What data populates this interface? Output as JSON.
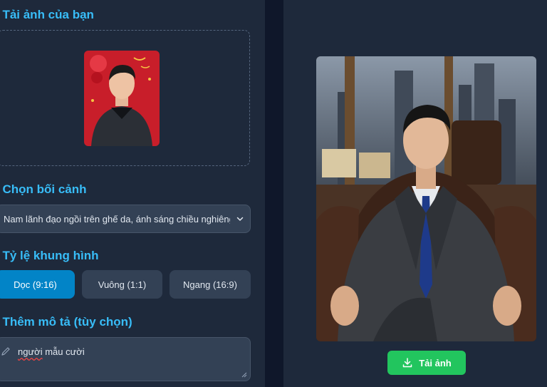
{
  "sections": {
    "upload": {
      "title": ". Tải ảnh của bạn"
    },
    "background": {
      "title": ". Chọn bối cảnh",
      "selected": "Nam lãnh đạo ngồi trên ghế da, ánh sáng chiều nghiêng"
    },
    "ratio": {
      "title": ". Tỷ lệ khung hình",
      "options": [
        {
          "label": "Dọc (9:16)",
          "active": true
        },
        {
          "label": "Vuông (1:1)",
          "active": false
        },
        {
          "label": "Ngang (16:9)",
          "active": false
        }
      ]
    },
    "description": {
      "title": ". Thêm mô tả (tùy chọn)",
      "value_prefix": "",
      "value_misspelled": "người",
      "value_rest": " mẫu cười"
    }
  },
  "result": {
    "download_label": "Tải ảnh"
  },
  "colors": {
    "accent": "#38bdf8",
    "active_button": "#0284c7",
    "download": "#22c55e",
    "panel": "#1e293b",
    "background": "#0f172a"
  },
  "icons": {
    "pencil": "pencil-icon",
    "download": "download-icon",
    "chevron": "chevron-down-icon"
  }
}
